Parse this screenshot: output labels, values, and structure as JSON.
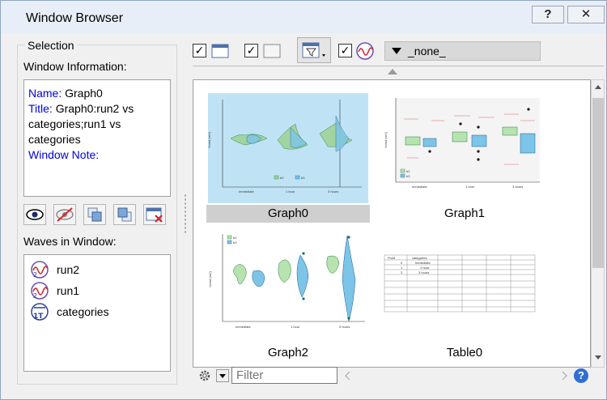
{
  "window": {
    "title": "Window Browser",
    "help_label": "?",
    "close_label": "✕"
  },
  "selection": {
    "group_label": "Selection",
    "info_label": "Window Information:",
    "info": {
      "name_key": "Name:",
      "name_value": "Graph0",
      "title_key": "Title:",
      "title_value": "Graph0:run2 vs categories;run1 vs categories",
      "note_key": "Window Note:"
    },
    "waves_label": "Waves in Window:",
    "waves": [
      "run2",
      "run1",
      "categories"
    ]
  },
  "toolbar": {
    "none_label": "_none_"
  },
  "thumbnails": [
    {
      "caption": "Graph0"
    },
    {
      "caption": "Graph1"
    },
    {
      "caption": "Graph2"
    },
    {
      "caption": "Table0"
    }
  ],
  "graph_text": {
    "y_axis": "Vcmd (mV)",
    "categories": [
      "Immediate",
      "1 hour",
      "3 hours"
    ],
    "legend": [
      "b2",
      "b3"
    ],
    "table_headers": [
      "Point",
      "categories"
    ],
    "table_rows": [
      [
        "0",
        "Immediate"
      ],
      [
        "1",
        "1 hour"
      ],
      [
        "2",
        "3 hours"
      ]
    ]
  },
  "filter": {
    "placeholder": "Filter"
  },
  "bottom": {
    "help_label": "?"
  },
  "colors": {
    "green_series": "#a6d8a0",
    "blue_series": "#7cc4e8",
    "selected_bg": "#cfcfcf",
    "key_text": "#0000e0"
  }
}
